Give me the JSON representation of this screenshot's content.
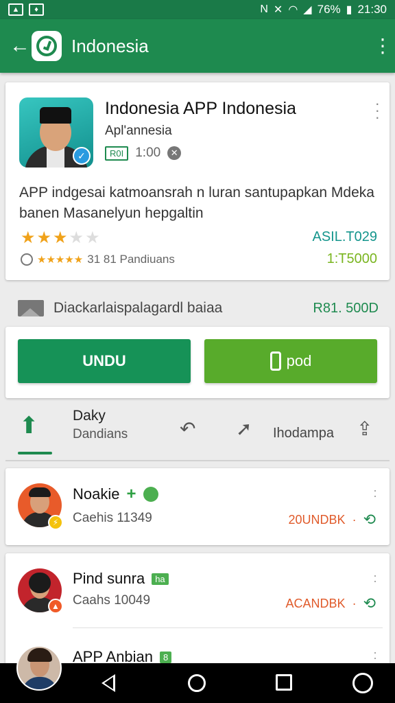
{
  "status_bar": {
    "left_icons": [
      "image-icon",
      "vpn-icon"
    ],
    "battery": "76%",
    "time": "21:30"
  },
  "toolbar": {
    "title": "Indonesia"
  },
  "app": {
    "name": "Indonesia APP Indonesia",
    "developer": "Apl'annesia",
    "age_badge": "R0I",
    "size": "1:00",
    "description": "APP indgesai katmoansrah n luran santupapkan Mdeka banen Masanelyun hepgaltin",
    "rating_stars": 3,
    "price_top": "ASIL.T029",
    "reviews_text": "31 81 Pandiuans",
    "price_bottom": "1:T5000"
  },
  "promo": {
    "text": "Diackarlaispalagardl baiaa",
    "price": "R81. 500D"
  },
  "buttons": {
    "undu": "UNDU",
    "pod": "pod"
  },
  "actions": {
    "first_label": "Daky",
    "second_label": "Dandians",
    "third_label": "Ihodampa"
  },
  "users": [
    {
      "name": "Noakie",
      "sub": "Caehis 11349",
      "status": "20UNDBK"
    },
    {
      "name": "Pind sunra",
      "tag": "ha",
      "sub": "Caahs 10049",
      "status": "ACANDBK"
    },
    {
      "name": "APP Anbian",
      "tag": "8"
    }
  ]
}
